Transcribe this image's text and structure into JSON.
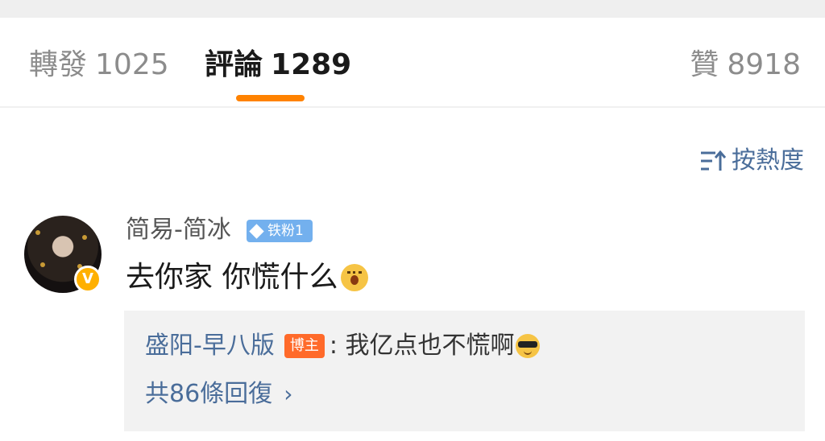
{
  "tabs": {
    "repost": {
      "label": "轉發",
      "count": "1025"
    },
    "comments": {
      "label": "評論",
      "count": "1289"
    },
    "likes": {
      "label": "贊",
      "count": "8918"
    }
  },
  "sort": {
    "label": "按熱度",
    "icon": "sort-icon"
  },
  "comment": {
    "username": "简易-简冰",
    "fan_badge": "铁粉1",
    "text": "去你家 你慌什么",
    "emoji": "surprised-emoji",
    "verified_icon": "V",
    "reply": {
      "author": "盛阳-早八版",
      "author_badge": "博主",
      "text": ": 我亿点也不慌啊",
      "emoji": "cool-emoji",
      "count_label": "共86條回復",
      "chevron": "›"
    }
  },
  "colors": {
    "accent": "#ff8200",
    "link": "#4a6d9a",
    "fan_badge": "#73b0ee",
    "blogger_badge": "#ff6a2a",
    "verified": "#ffb000"
  }
}
